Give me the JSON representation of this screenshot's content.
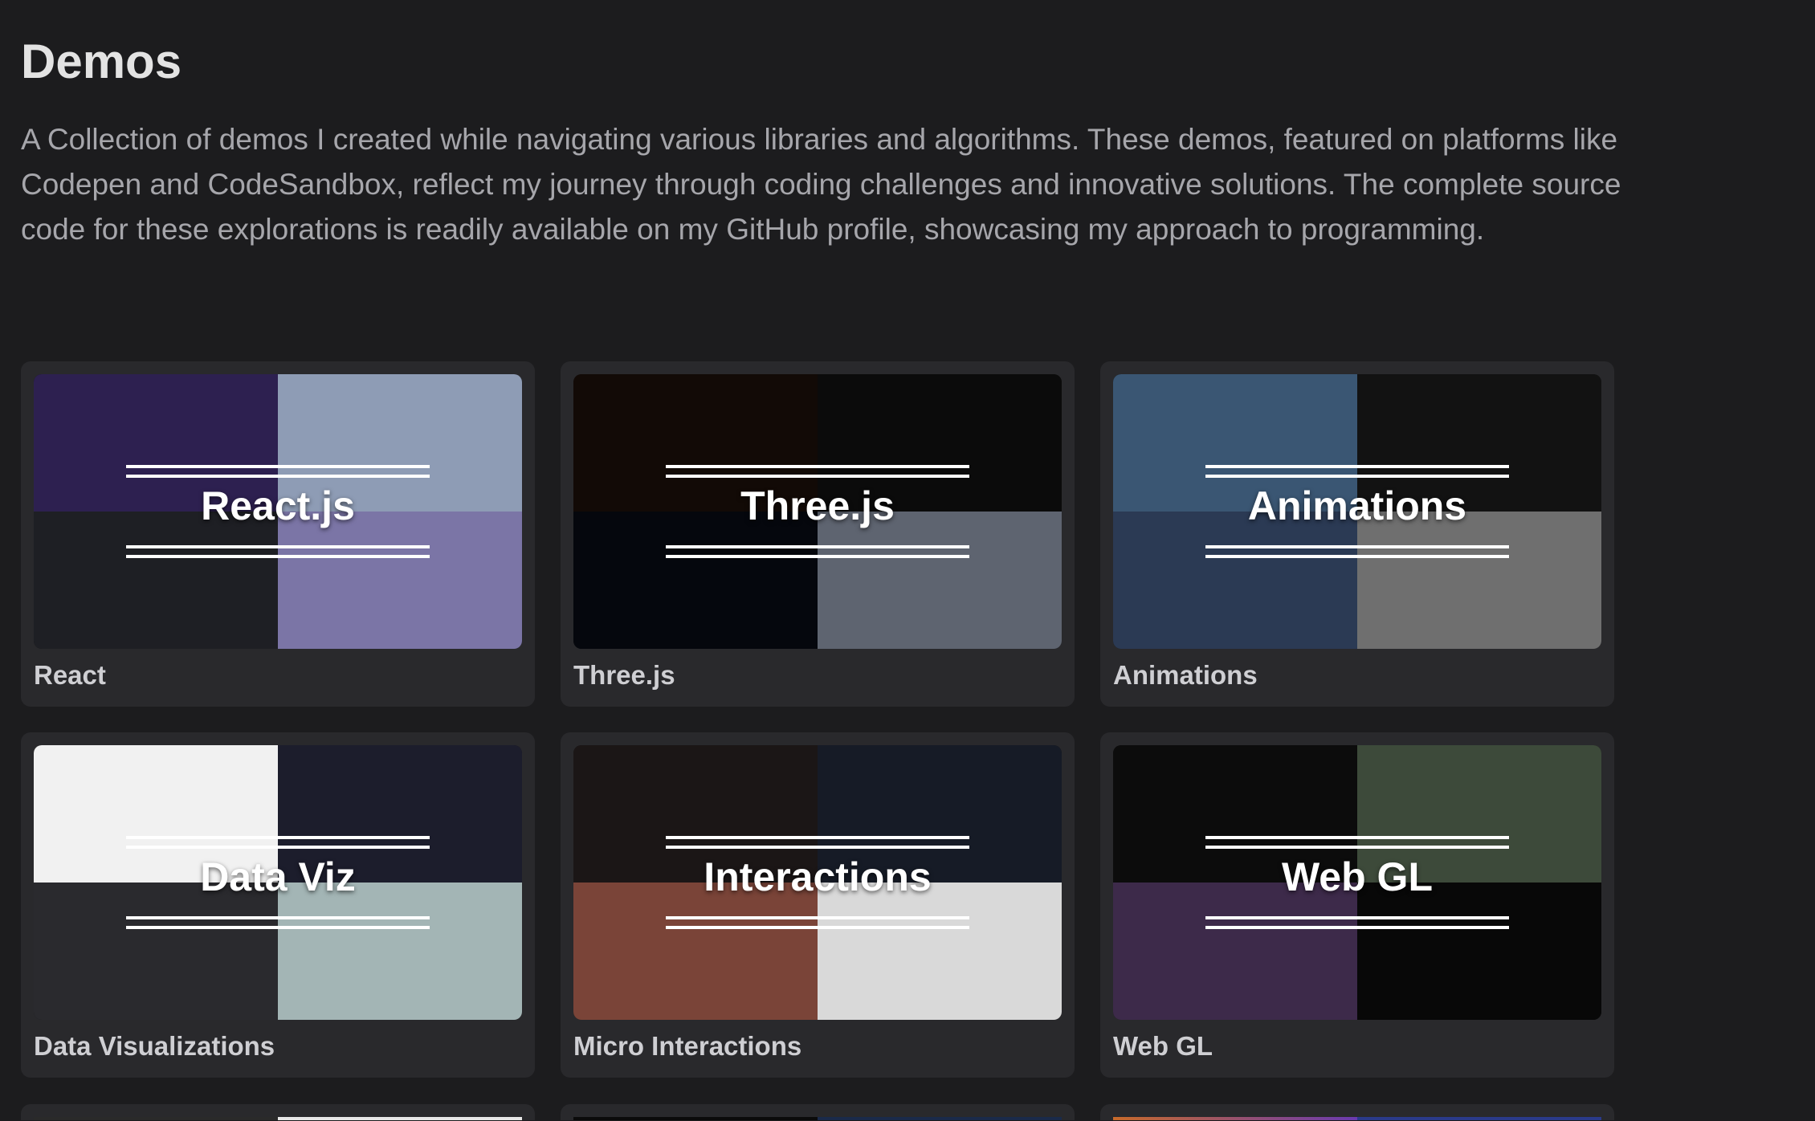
{
  "header": {
    "title": "Demos",
    "description": "A Collection of demos I created while navigating various libraries and algorithms. These demos, featured on platforms like Codepen and CodeSandbox, reflect my journey through coding challenges and innovative solutions. The complete source code for these explorations is readily available on my GitHub profile, showcasing my approach to programming."
  },
  "cards": [
    {
      "overlay": "React.js",
      "label": "React",
      "quads": [
        "#2d2050",
        "#8e9cb5",
        "#1e1f24",
        "#7b75a6"
      ]
    },
    {
      "overlay": "Three.js",
      "label": "Three.js",
      "quads": [
        "#120a06",
        "#0b0b0b",
        "#05070d",
        "#5e6470"
      ]
    },
    {
      "overlay": "Animations",
      "label": "Animations",
      "quads": [
        "#3a5673",
        "#121212",
        "#2b3a54",
        "#6f6f6f"
      ]
    },
    {
      "overlay": "Data Viz",
      "label": "Data Visualizations",
      "quads": [
        "#f1f1f1",
        "#1c1d2c",
        "#2a2a2e",
        "#a3b5b5"
      ]
    },
    {
      "overlay": "Interactions",
      "label": "Micro Interactions",
      "quads": [
        "#1b1616",
        "#161b26",
        "#7a4438",
        "#d9d9d9"
      ]
    },
    {
      "overlay": "Web GL",
      "label": "Web GL",
      "quads": [
        "#0c0c0c",
        "#3d4a3a",
        "#3d2a4a",
        "#080808"
      ]
    }
  ]
}
